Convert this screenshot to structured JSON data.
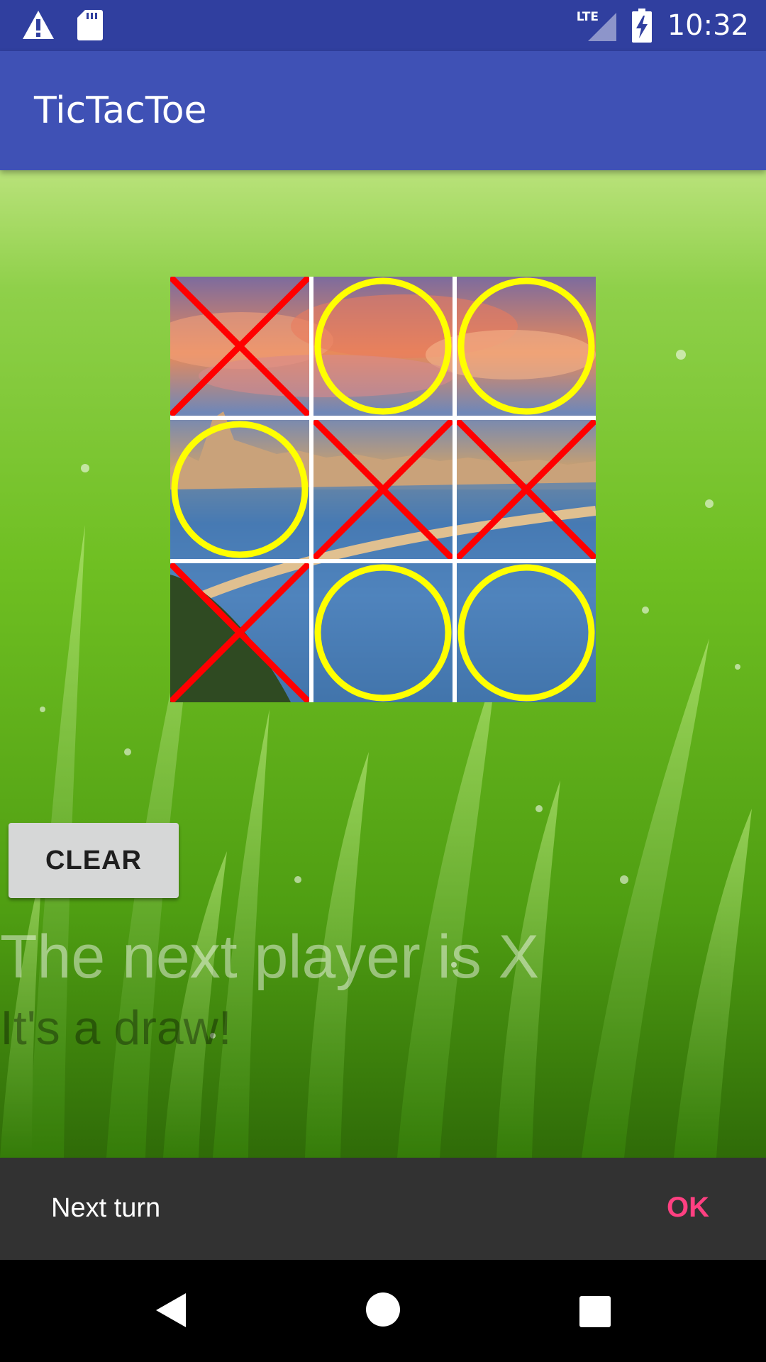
{
  "status_bar": {
    "time": "10:32",
    "network": "LTE",
    "icons": [
      "warning-icon",
      "sd-card-icon",
      "signal-icon",
      "battery-charging-icon"
    ]
  },
  "app_bar": {
    "title": "TicTacToe"
  },
  "board": {
    "cells": [
      "X",
      "O",
      "O",
      "O",
      "X",
      "X",
      "X",
      "O",
      "O"
    ],
    "x_color": "#FF0000",
    "o_color": "#FFFF00"
  },
  "controls": {
    "clear_label": "CLEAR"
  },
  "game": {
    "next_player_text": "The next player is X",
    "result_text": "It's a draw!"
  },
  "snackbar": {
    "message": "Next turn",
    "action": "OK",
    "action_color": "#FF4081"
  },
  "nav": {
    "icons": [
      "back-icon",
      "home-icon",
      "recents-icon"
    ]
  }
}
